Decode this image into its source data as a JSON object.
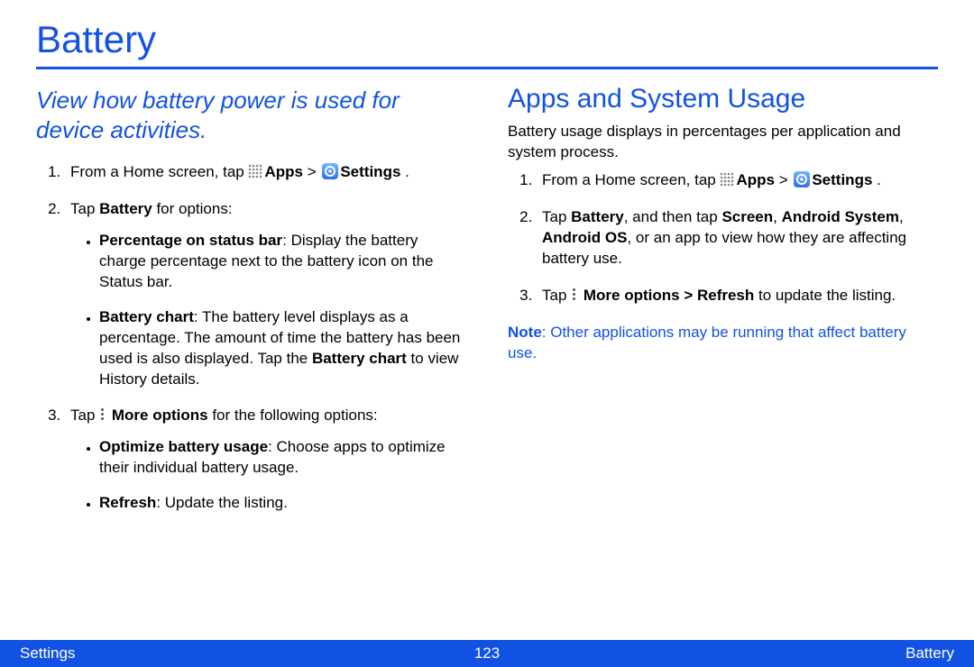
{
  "title": "Battery",
  "intro": "View how battery power is used for device activities.",
  "left": {
    "step1_a": "From a Home screen, tap ",
    "apps": "Apps",
    "gt": " > ",
    "settings": "Settings",
    "period": " .",
    "step2_a": "Tap ",
    "step2_b": "Battery",
    "step2_c": " for options:",
    "b1_t": "Percentage on status bar",
    "b1_r": ": Display the battery charge percentage next to the battery icon on the Status bar.",
    "b2_t": "Battery chart",
    "b2_r1": ": The battery level displays as a percentage. The amount of time the battery has been used is also displayed. Tap the ",
    "b2_r2": "Battery chart",
    "b2_r3": " to view History details.",
    "step3_a": "Tap ",
    "step3_b": "More options",
    "step3_c": " for the following options:",
    "b3_t": "Optimize battery usage",
    "b3_r": ": Choose apps to optimize their individual battery usage.",
    "b4_t": "Refresh",
    "b4_r": ": Update the listing."
  },
  "right": {
    "h2": "Apps and System Usage",
    "intro": "Battery usage displays in percentages per application and system process.",
    "step1_a": "From a Home screen, tap ",
    "apps": "Apps",
    "gt": " > ",
    "settings": "Settings",
    "period": " .",
    "step2_a": "Tap ",
    "step2_b": "Battery",
    "step2_c": ", and then tap ",
    "step2_d": "Screen",
    "step2_e": ", ",
    "step2_f": "Android System",
    "step2_g": ", ",
    "step2_h": "Android OS",
    "step2_i": ", or an app to view how they are affecting battery use.",
    "step3_a": "Tap ",
    "step3_b": "More options > Refresh",
    "step3_c": " to update the listing.",
    "note_label": "Note",
    "note_text": ": Other applications may be running that affect battery use."
  },
  "footer": {
    "left": "Settings",
    "page": "123",
    "right": "Battery"
  }
}
